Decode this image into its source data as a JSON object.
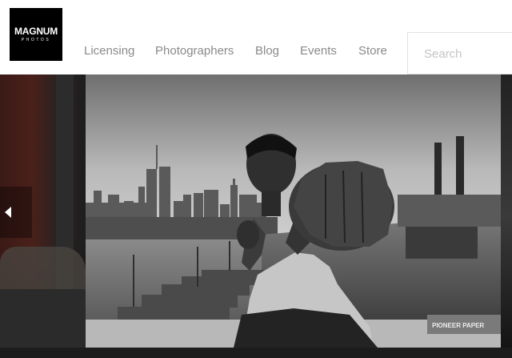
{
  "logo": {
    "word": "MAGNUM",
    "sub": "PHOTOS"
  },
  "nav": {
    "items": [
      "Licensing",
      "Photographers",
      "Blog",
      "Events",
      "Store"
    ]
  },
  "search": {
    "placeholder": "Search",
    "value": ""
  },
  "carousel": {
    "prev_icon": "chevron-left-icon"
  },
  "photo": {
    "sign_text": "PIONEER PAPER"
  }
}
